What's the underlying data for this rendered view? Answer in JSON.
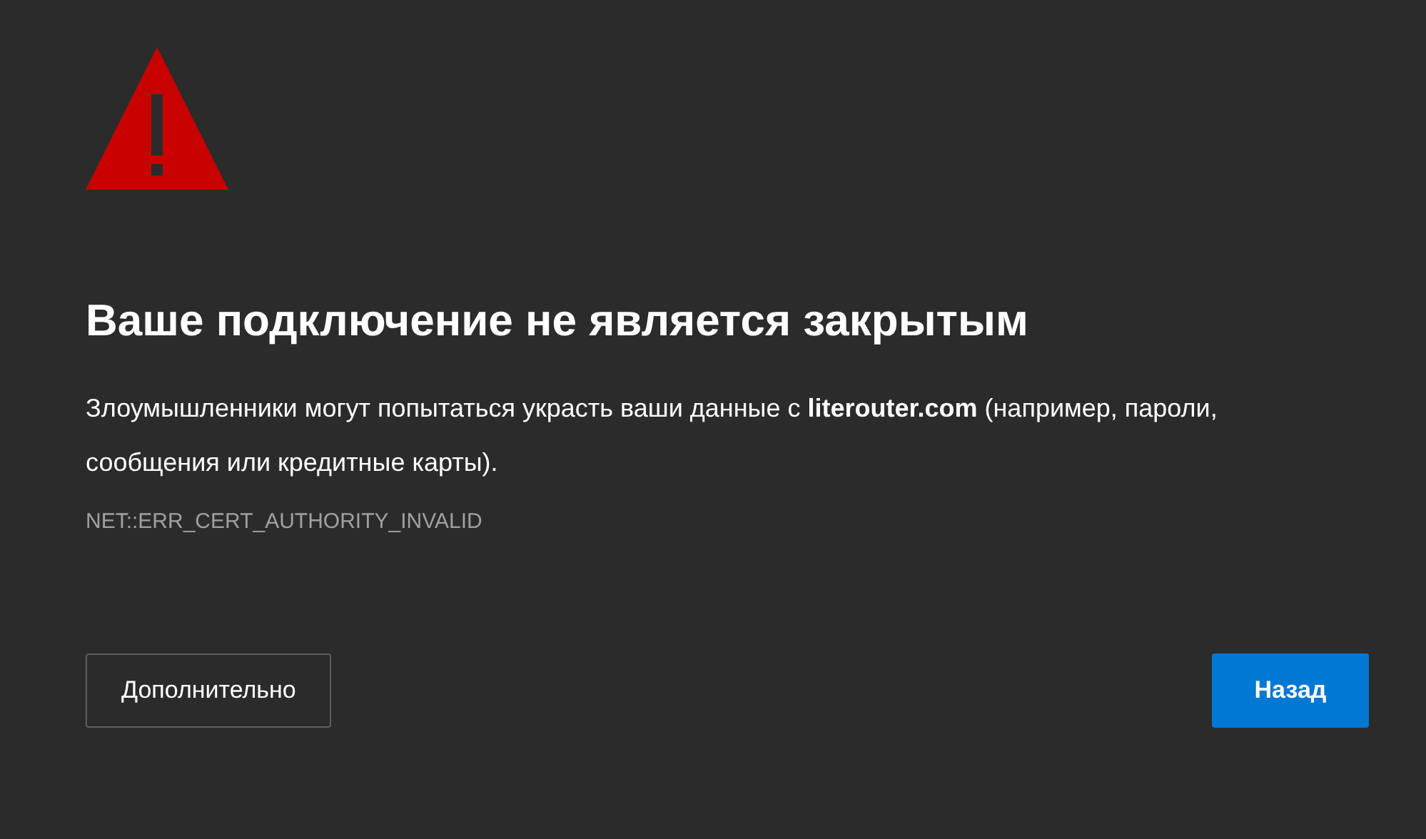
{
  "heading": "Ваше подключение не является закрытым",
  "message": "Злоумышленники могут попытаться украсть ваши данные с **literouter.com** (например, пароли, сообщения или кредитные карты).",
  "error_code": "NET::ERR_CERT_AUTHORITY_INVALID",
  "buttons": [
    {
      "label": "Дополнительно",
      "kind": "secondary"
    },
    {
      "label": "Назад",
      "kind": "primary"
    }
  ]
}
